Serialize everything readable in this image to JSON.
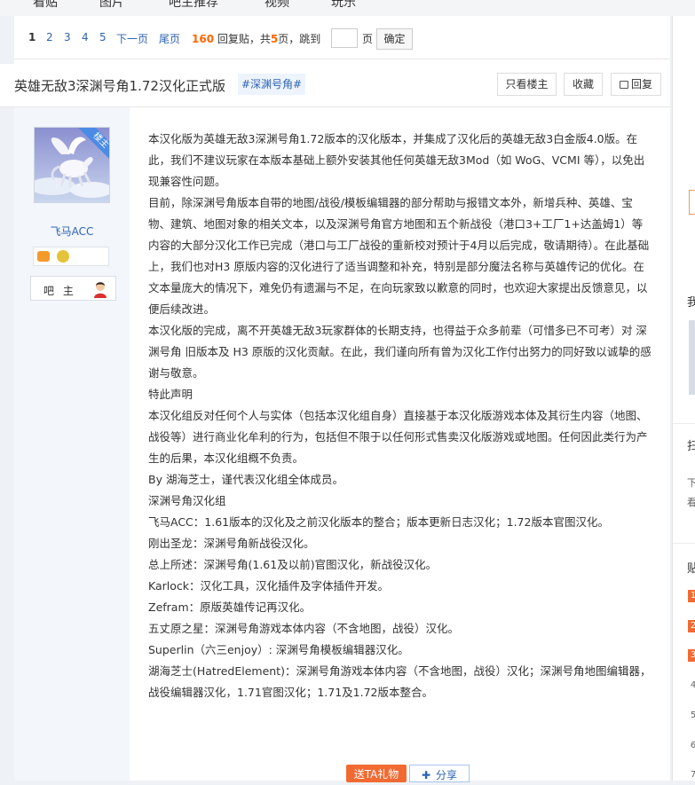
{
  "topnav": {
    "items": [
      "看贴",
      "图片",
      "吧主推荐",
      "视频",
      "玩乐"
    ]
  },
  "pager": {
    "pages": [
      "1",
      "2",
      "3",
      "4",
      "5"
    ],
    "next": "下一页",
    "last": "尾页",
    "reply_count": "160",
    "reply_suffix": "回复贴，共",
    "page_count": "5",
    "page_suffix": "页，跳到",
    "jump_suffix": "页",
    "confirm": "确定"
  },
  "thread": {
    "title": "英雄无敌3深渊号角1.72汉化正式版",
    "tag": "#深渊号角#",
    "buttons": {
      "only_op": "只看楼主",
      "favorite": "收藏",
      "reply": "回复"
    }
  },
  "author": {
    "ribbon": "楼主",
    "name": "飞马ACC",
    "role": "吧 主"
  },
  "post": {
    "paragraphs": [
      "本汉化版为英雄无敌3深渊号角1.72版本的汉化版本，并集成了汉化后的英雄无敌3白金版4.0版。在此，我们不建议玩家在本版本基础上额外安装其他任何英雄无敌3Mod（如 WoG、VCMI 等），以免出现兼容性问题。",
      "目前，除深渊号角版本自带的地图/战役/模板编辑器的部分帮助与报错文本外，新增兵种、英雄、宝物、建筑、地图对象的相关文本，以及深渊号角官方地图和五个新战役（港口3+工厂1+达盖姆1）等内容的大部分汉化工作已完成（港口与工厂战役的重新校对预计于4月以后完成，敬请期待）。在此基础上，我们也对H3 原版内容的汉化进行了适当调整和补充，特别是部分魔法名称与英雄传记的优化。在文本量庞大的情况下，难免仍有遗漏与不足，在向玩家致以歉意的同时，也欢迎大家提出反馈意见，以便后续改进。",
      "本汉化版的完成，离不开英雄无敌3玩家群体的长期支持，也得益于众多前辈（可惜多已不可考）对 深渊号角 旧版本及 H3 原版的汉化贡献。在此，我们谨向所有曾为汉化工作付出努力的同好致以诚挚的感谢与敬意。",
      "特此声明",
      "本汉化组反对任何个人与实体（包括本汉化组自身）直接基于本汉化版游戏本体及其衍生内容（地图、战役等）进行商业化牟利的行为，包括但不限于以任何形式售卖汉化版游戏或地图。任何因此类行为产生的后果，本汉化组概不负责。",
      "By 湖海芝士，谨代表汉化组全体成员。",
      "深渊号角汉化组",
      "飞马ACC：1.61版本的汉化及之前汉化版本的整合；版本更新日志汉化；1.72版本官图汉化。",
      "刚出圣龙：深渊号角新战役汉化。",
      "总上所述：深渊号角(1.61及以前)官图汉化，新战役汉化。",
      "Karlock：汉化工具，汉化插件及字体插件开发。",
      "Zefram：原版英雄传记再汉化。",
      "五丈原之星：深渊号角游戏本体内容（不含地图，战役）汉化。",
      "Superlin（六三enjoy）: 深渊号角模板编辑器汉化。",
      "湖海芝士(HatredElement)：深渊号角游戏本体内容（不含地图，战役）汉化；深渊号角地图编辑器，战役编辑器汉化，1.71官图汉化；1.71及1.72版本整合。"
    ],
    "gift_button": "送TA礼物",
    "share_button": "分享"
  },
  "sidebar": {
    "glyphs": [
      "我",
      "扫",
      "下",
      "看",
      "贴"
    ],
    "rank_numbers": [
      "1",
      "2",
      "3",
      "4",
      "5",
      "6",
      "7"
    ]
  },
  "colors": {
    "link": "#2d64b3",
    "accent": "#f60",
    "ribbon": "#4a8be5",
    "gift": "#f26a32",
    "rank_hot": "#f26a32"
  }
}
